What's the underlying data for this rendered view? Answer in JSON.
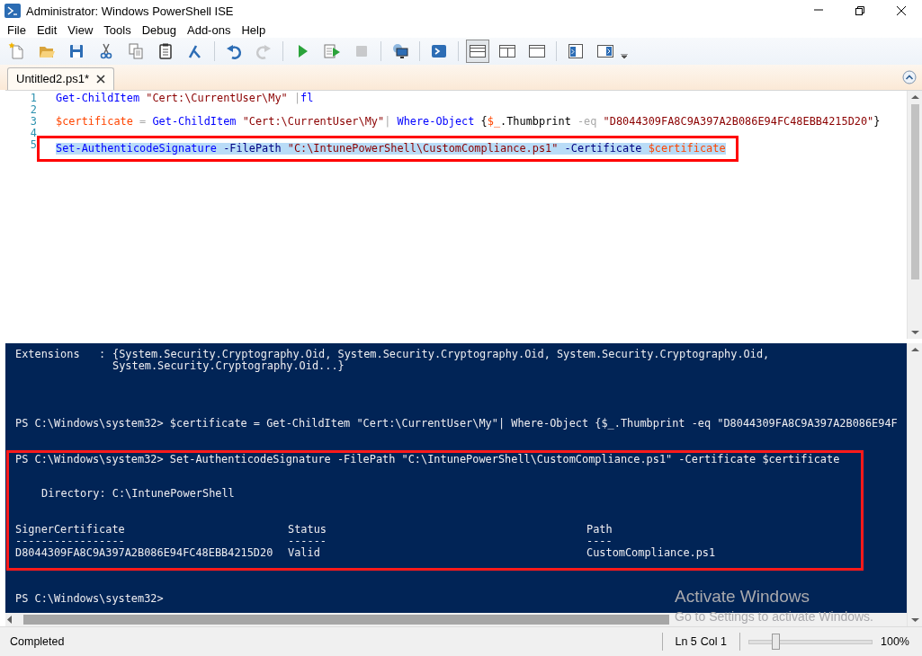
{
  "window": {
    "title": "Administrator: Windows PowerShell ISE"
  },
  "menu": [
    "File",
    "Edit",
    "View",
    "Tools",
    "Debug",
    "Add-ons",
    "Help"
  ],
  "toolbar": [
    [
      {
        "kind": "new",
        "disabled": false
      },
      {
        "kind": "open",
        "disabled": false
      },
      {
        "kind": "save",
        "disabled": false
      },
      {
        "kind": "cut",
        "disabled": false
      },
      {
        "kind": "copy",
        "disabled": false
      },
      {
        "kind": "paste",
        "disabled": false
      },
      {
        "kind": "clear",
        "disabled": false
      }
    ],
    [
      {
        "kind": "undo",
        "disabled": false
      },
      {
        "kind": "redo",
        "disabled": true
      }
    ],
    [
      {
        "kind": "run",
        "disabled": false
      },
      {
        "kind": "run-selection",
        "disabled": false
      },
      {
        "kind": "stop",
        "disabled": true
      }
    ],
    [
      {
        "kind": "remote",
        "disabled": false
      }
    ],
    [
      {
        "kind": "console",
        "disabled": false
      }
    ],
    [
      {
        "kind": "layout-top",
        "disabled": false,
        "selected": true
      },
      {
        "kind": "layout-right",
        "disabled": false,
        "selected": false
      },
      {
        "kind": "layout-max",
        "disabled": false,
        "selected": false
      }
    ],
    [
      {
        "kind": "show-script",
        "disabled": false
      },
      {
        "kind": "show-commands",
        "disabled": false
      }
    ]
  ],
  "tabs": [
    {
      "label": "Untitled2.ps1*",
      "selected": true
    }
  ],
  "script": {
    "lines": [
      {
        "number": "1",
        "selected": false,
        "boxed": false,
        "tokens": [
          {
            "text": "Get-ChildItem ",
            "kind": "command"
          },
          {
            "text": "\"Cert:\\CurrentUser\\My\" ",
            "kind": "string"
          },
          {
            "text": "|",
            "kind": "operator"
          },
          {
            "text": "fl",
            "kind": "command"
          }
        ]
      },
      {
        "number": "2",
        "selected": false,
        "boxed": false
      },
      {
        "number": "3",
        "selected": false,
        "boxed": false,
        "tokens": [
          {
            "text": "$certificate ",
            "kind": "variable"
          },
          {
            "text": "= ",
            "kind": "operator"
          },
          {
            "text": "Get-ChildItem ",
            "kind": "command"
          },
          {
            "text": "\"Cert:\\CurrentUser\\My\"",
            "kind": "string"
          },
          {
            "text": "| ",
            "kind": "operator"
          },
          {
            "text": "Where-Object ",
            "kind": "command"
          },
          {
            "text": "{",
            "kind": "plain"
          },
          {
            "text": "$_",
            "kind": "variable"
          },
          {
            "text": ".Thumbprint ",
            "kind": "plain"
          },
          {
            "text": "-eq ",
            "kind": "operator"
          },
          {
            "text": "\"D8044309FA8C9A397A2B086E94FC48EBB4215D20\"",
            "kind": "string"
          },
          {
            "text": "}",
            "kind": "plain"
          }
        ]
      },
      {
        "number": "4",
        "selected": false,
        "boxed": false
      },
      {
        "number": "5",
        "selected": true,
        "boxed": true,
        "tokens": [
          {
            "text": "Set-AuthenticodeSignature ",
            "kind": "command"
          },
          {
            "text": "-FilePath ",
            "kind": "parameter"
          },
          {
            "text": "\"C:\\IntunePowerShell\\CustomCompliance.ps1\" ",
            "kind": "string"
          },
          {
            "text": "-Certificate ",
            "kind": "parameter"
          },
          {
            "text": "$certificate",
            "kind": "variable"
          }
        ]
      }
    ]
  },
  "console": {
    "blocks": [
      {
        "boxed": false,
        "items": [
          {
            "kind": "property",
            "name": "Extensions",
            "separator": ":",
            "values": [
              "{System.Security.Cryptography.Oid, System.Security.Cryptography.Oid, System.Security.Cryptography.Oid,",
              "System.Security.Cryptography.Oid...}"
            ]
          }
        ]
      },
      {
        "boxed": false,
        "items": [
          {
            "kind": "command",
            "text": "PS C:\\Windows\\system32> $certificate = Get-ChildItem \"Cert:\\CurrentUser\\My\"| Where-Object {$_.Thumbprint -eq \"D8044309FA8C9A397A2B086E94F"
          }
        ]
      },
      {
        "boxed": true,
        "items": [
          {
            "kind": "command",
            "text": "PS C:\\Windows\\system32> Set-AuthenticodeSignature -FilePath \"C:\\IntunePowerShell\\CustomCompliance.ps1\" -Certificate $certificate"
          },
          {
            "kind": "directory",
            "text": "Directory: C:\\IntunePowerShell"
          },
          {
            "kind": "table",
            "columns": [
              "SignerCertificate",
              "Status",
              "Path"
            ],
            "rules": [
              "-----------------",
              "------",
              "----"
            ],
            "rows": [
              [
                "D8044309FA8C9A397A2B086E94FC48EBB4215D20",
                "Valid",
                "CustomCompliance.ps1"
              ]
            ]
          }
        ]
      },
      {
        "boxed": false,
        "items": [
          {
            "kind": "command",
            "text": "PS C:\\Windows\\system32>"
          }
        ]
      }
    ]
  },
  "activation_notice": {
    "title": "Activate Windows",
    "message": "Go to Settings to activate Windows."
  },
  "status": {
    "message": "Completed",
    "line": "Ln 5",
    "column": "Col 1",
    "zoom": {
      "level": 0.21,
      "reading": "100%"
    }
  }
}
